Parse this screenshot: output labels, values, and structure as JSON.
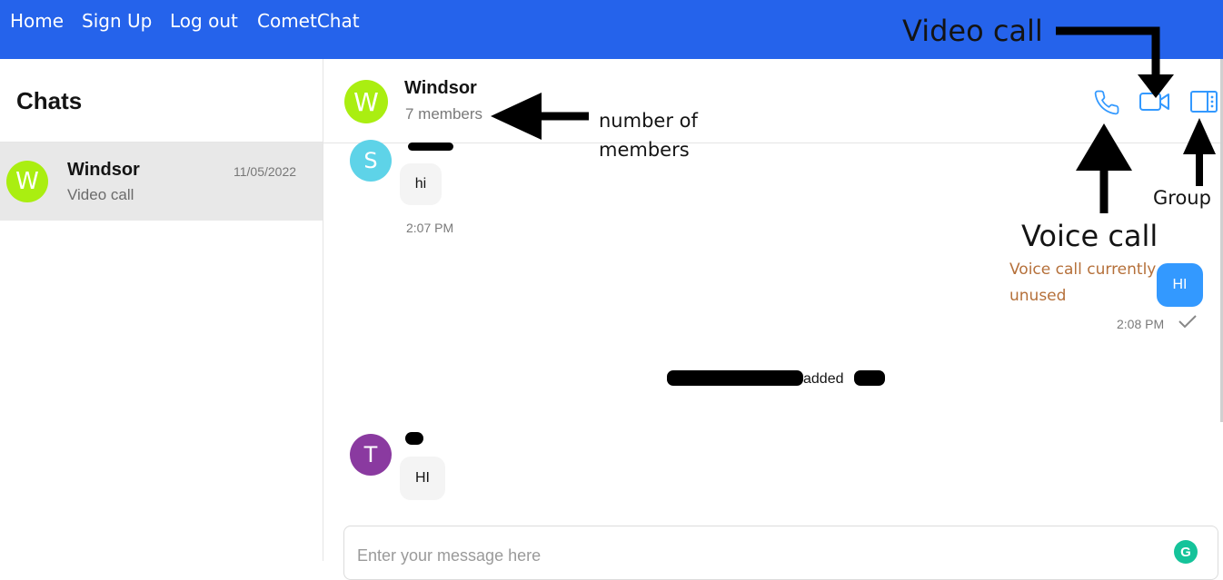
{
  "nav": {
    "home": "Home",
    "signup": "Sign Up",
    "logout": "Log out",
    "brand": "CometChat"
  },
  "sidebar": {
    "title": "Chats",
    "items": [
      {
        "avatar_letter": "W",
        "name": "Windsor",
        "date": "11/05/2022",
        "preview": "Video call"
      }
    ]
  },
  "header": {
    "avatar_letter": "W",
    "name": "Windsor",
    "members": "7 members",
    "icons": [
      "phone-icon",
      "video-camera-icon",
      "group-details-icon"
    ]
  },
  "messages": {
    "first": {
      "avatar_letter": "S",
      "text": "hi",
      "time": "2:07 PM"
    },
    "own": {
      "text": "HI",
      "time": "2:08 PM"
    },
    "system": {
      "text": "added"
    },
    "second": {
      "avatar_letter": "T",
      "text": "HI"
    }
  },
  "annotations": {
    "video_call": "Video call",
    "members_line1": "number of",
    "members_line2": "members",
    "group": "Group",
    "voice_call": "Voice call",
    "voice_unused_line1": "Voice call currently",
    "voice_unused_line2": "unused"
  },
  "composer": {
    "placeholder": "Enter your message here"
  },
  "colors": {
    "accent": "#2563eb",
    "icon_blue": "#39f",
    "avatar_w": "#aaee11",
    "avatar_s": "#5ed3e8",
    "avatar_t": "#8a3aa0",
    "own_bubble": "#3399ff",
    "annotation_brown": "#b5703a"
  }
}
